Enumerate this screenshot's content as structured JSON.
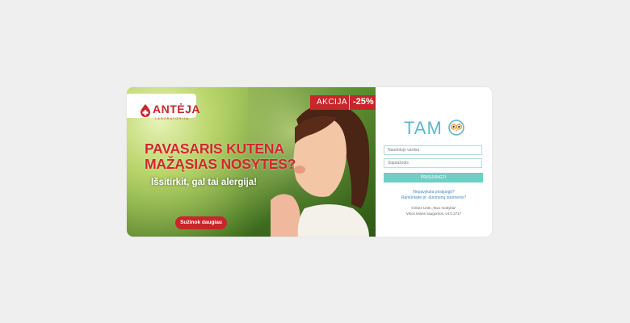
{
  "ad": {
    "brand": "ANTĖJA",
    "brand_sub": "LABORATORIJA",
    "promo_label": "AKCIJA",
    "promo_discount": "-25%",
    "headline_line1": "PAVASARIS KUTENA",
    "headline_line2": "MAŽĄSIAS NOSYTES?",
    "subline": "Išsitirkit, gal tai alergija!",
    "cta_label": "Sužinok daugiau",
    "colors": {
      "brand_red": "#c8262a",
      "headline_red": "#d3262e"
    }
  },
  "login": {
    "logo_text": "TAM",
    "username_placeholder": "Naudotojo vardas",
    "password_placeholder": "Slaptažodis",
    "submit_label": "PRISIJUNGTI",
    "link_forgot": "Nepavyksta prisijungti?",
    "link_privacy": "Ramūnlaite pr. duomenų duomenis?",
    "footer_line1": "©2021 UAB „Tavo mokykla\"",
    "footer_line2": "Visos teisės saugomos. v4.0.2717",
    "colors": {
      "accent": "#6fcfc5",
      "logo": "#5eb8c8",
      "link": "#3b8bc4"
    }
  }
}
